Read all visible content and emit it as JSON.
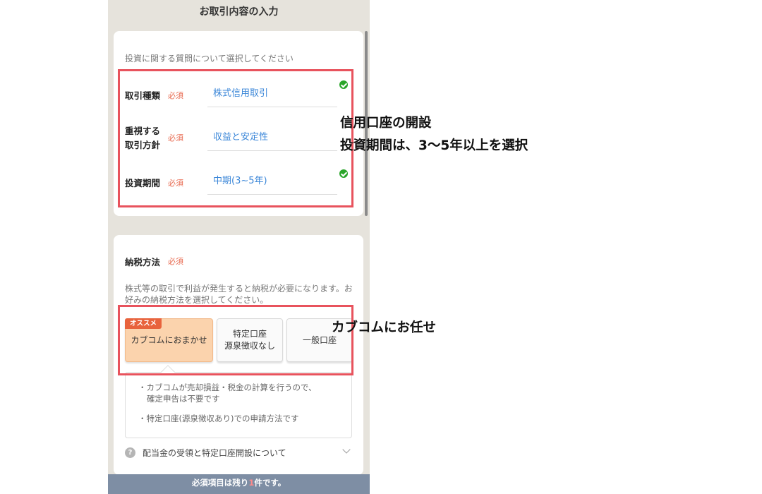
{
  "page": {
    "title": "お取引内容の入力"
  },
  "card1": {
    "intro": "投資に関する質問について選択してください",
    "rows": [
      {
        "label_lines": [
          "取引種類"
        ],
        "required": "必須",
        "value": "株式信用取引",
        "checked": true
      },
      {
        "label_lines": [
          "重視する",
          "取引方針"
        ],
        "required": "必須",
        "value": "収益と安定性",
        "checked": false
      },
      {
        "label_lines": [
          "投資期間"
        ],
        "required": "必須",
        "value": "中期(3~5年)",
        "checked": true
      }
    ]
  },
  "card2": {
    "title": "納税方法",
    "required": "必須",
    "description": "株式等の取引で利益が発生すると納税が必要になります。お好みの納税方法を選択してください。",
    "badge": "オススメ",
    "options": [
      {
        "lines": [
          "カブコムにおまかせ"
        ],
        "selected": true
      },
      {
        "lines": [
          "特定口座",
          "源泉徴収なし"
        ],
        "selected": false
      },
      {
        "lines": [
          "一般口座"
        ],
        "selected": false
      }
    ],
    "info": {
      "line1a": "・カブコムが売却損益・税金の計算を行うので、",
      "line1b": "確定申告は不要です",
      "line2": "・特定口座(源泉徴収あり)での申請方法です"
    },
    "help": {
      "icon": "?",
      "text": "配当金の受領と特定口座開設について"
    }
  },
  "footer": {
    "prefix": "必須項目は残り",
    "count": "1",
    "suffix": "件です。"
  },
  "annotations": {
    "note1_line1": "信用口座の開設",
    "note1_line2": "投資期間は、3〜5年以上を選択",
    "note2": "カブコムにお任せ"
  },
  "colors": {
    "annotation_box": "#e8535d",
    "link_value": "#3a86d8",
    "required": "#e86a50",
    "selected_option": "#fbd3ad",
    "badge": "#e8633d"
  }
}
